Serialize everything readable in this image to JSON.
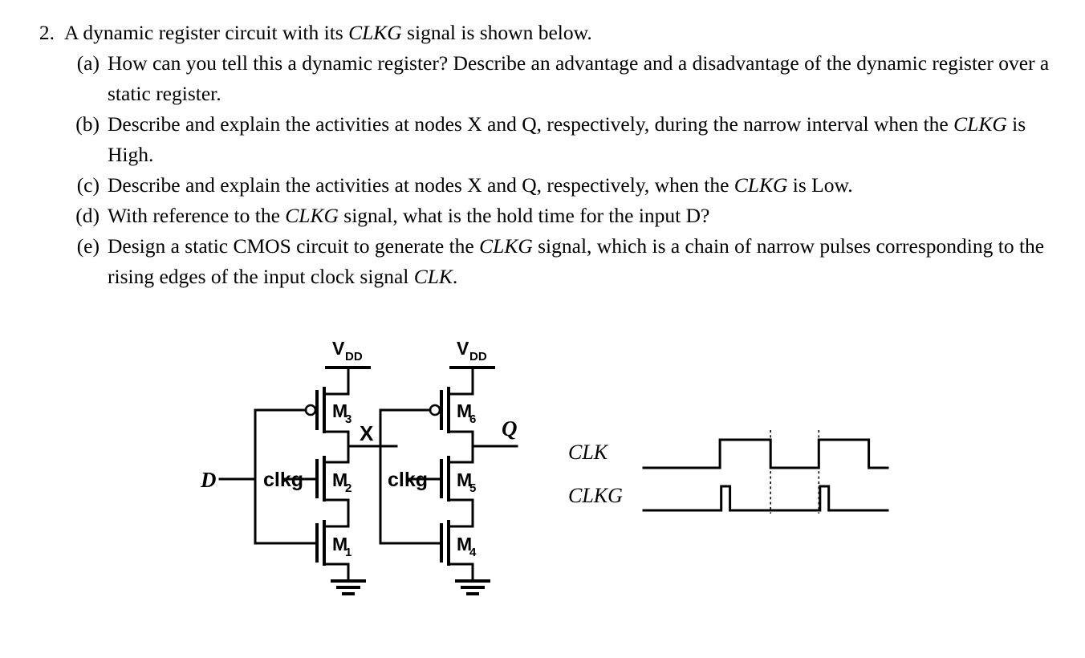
{
  "document": {
    "question_number": "2.",
    "question_stem_parts": [
      {
        "t": "A dynamic register circuit with its ",
        "i": false
      },
      {
        "t": "CLKG",
        "i": true
      },
      {
        "t": " signal is shown below.",
        "i": false
      }
    ],
    "sub_questions": [
      {
        "marker": "(a)",
        "parts": [
          {
            "t": "How can you tell this a dynamic register? Describe an advantage and a disadvantage of the dynamic register over a static register.",
            "i": false
          }
        ]
      },
      {
        "marker": "(b)",
        "parts": [
          {
            "t": "Describe and explain the activities at nodes X and Q, respectively, during the narrow interval when the ",
            "i": false
          },
          {
            "t": "CLKG",
            "i": true
          },
          {
            "t": " is High.",
            "i": false
          }
        ]
      },
      {
        "marker": "(c)",
        "parts": [
          {
            "t": "Describe and explain the activities at nodes X and Q, respectively, when the ",
            "i": false
          },
          {
            "t": "CLKG",
            "i": true
          },
          {
            "t": " is Low.",
            "i": false
          }
        ]
      },
      {
        "marker": "(d)",
        "parts": [
          {
            "t": "With reference to the ",
            "i": false
          },
          {
            "t": "CLKG",
            "i": true
          },
          {
            "t": " signal, what is the hold time for the input D?",
            "i": false
          }
        ]
      },
      {
        "marker": "(e)",
        "parts": [
          {
            "t": "Design a static CMOS circuit to generate the ",
            "i": false
          },
          {
            "t": "CLKG",
            "i": true
          },
          {
            "t": " signal, which is a chain of narrow pulses corresponding to the rising edges of the input clock signal ",
            "i": false
          },
          {
            "t": "CLK",
            "i": true
          },
          {
            "t": ".",
            "i": false
          }
        ]
      }
    ]
  },
  "circuit": {
    "title": "dynamic register (two cascaded clocked inverter stages)",
    "supply_label_main": "V",
    "supply_label_sub": "DD",
    "input_label": "D",
    "node_x_label": "X",
    "node_q_label": "Q",
    "clock_gate_label": "clkg",
    "transistors": [
      {
        "name_main": "M",
        "name_sub": "1",
        "type": "nmos",
        "stage": "left",
        "role": "clkg-footer"
      },
      {
        "name_main": "M",
        "name_sub": "2",
        "type": "nmos",
        "stage": "left",
        "role": "data-input"
      },
      {
        "name_main": "M",
        "name_sub": "3",
        "type": "pmos",
        "stage": "left",
        "role": "clkg-precharge"
      },
      {
        "name_main": "M",
        "name_sub": "4",
        "type": "nmos",
        "stage": "right",
        "role": "clkg-footer"
      },
      {
        "name_main": "M",
        "name_sub": "5",
        "type": "nmos",
        "stage": "right",
        "role": "data-input"
      },
      {
        "name_main": "M",
        "name_sub": "6",
        "type": "pmos",
        "stage": "right",
        "role": "clkg-precharge"
      }
    ],
    "ground_symbol": "earth-ground",
    "stroke_color": "#000000"
  },
  "chart_data": {
    "type": "line",
    "title": "",
    "xlabel": "",
    "ylabel": "",
    "description": "Digital timing waveform: CLK square wave and CLKG narrow pulses aligned with the rising edges of CLK.",
    "xlim": [
      0,
      390
    ],
    "grid": false,
    "gridlines_vertical": [
      122,
      203,
      280
    ],
    "legend": "none",
    "series": [
      {
        "name": "CLK",
        "label": "CLK",
        "logic_levels": {
          "low": 0,
          "high": 1
        },
        "transitions": [
          {
            "x": 0,
            "level": 0
          },
          {
            "x": 122,
            "level": 1
          },
          {
            "x": 203,
            "level": 0
          },
          {
            "x": 280,
            "level": 1
          },
          {
            "x": 360,
            "level": 0
          },
          {
            "x": 390,
            "level": 0
          }
        ]
      },
      {
        "name": "CLKG",
        "label": "CLKG",
        "logic_levels": {
          "low": 0,
          "high": 1
        },
        "transitions": [
          {
            "x": 0,
            "level": 0
          },
          {
            "x": 124,
            "level": 1
          },
          {
            "x": 138,
            "level": 0
          },
          {
            "x": 282,
            "level": 1
          },
          {
            "x": 296,
            "level": 0
          },
          {
            "x": 390,
            "level": 0
          }
        ]
      }
    ]
  }
}
